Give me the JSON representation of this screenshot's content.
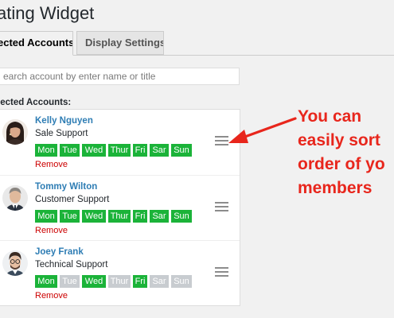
{
  "page_title": "ating Widget",
  "tabs": [
    {
      "label": "ected Accounts",
      "active": true
    },
    {
      "label": "Display Settings",
      "active": false
    }
  ],
  "search": {
    "placeholder": "earch account by enter name or title",
    "value": ""
  },
  "selected_label": "lected Accounts:",
  "members": [
    {
      "name": "Kelly Nguyen",
      "role": "Sale Support",
      "avatar_icon": "woman-portrait-icon",
      "days": [
        {
          "label": "Mon",
          "active": true
        },
        {
          "label": "Tue",
          "active": true
        },
        {
          "label": "Wed",
          "active": true
        },
        {
          "label": "Thur",
          "active": true
        },
        {
          "label": "Fri",
          "active": true
        },
        {
          "label": "Sar",
          "active": true
        },
        {
          "label": "Sun",
          "active": true
        }
      ],
      "remove_label": "Remove"
    },
    {
      "name": "Tommy Wilton",
      "role": "Customer Support",
      "avatar_icon": "man-portrait-icon",
      "days": [
        {
          "label": "Mon",
          "active": true
        },
        {
          "label": "Tue",
          "active": true
        },
        {
          "label": "Wed",
          "active": true
        },
        {
          "label": "Thur",
          "active": true
        },
        {
          "label": "Fri",
          "active": true
        },
        {
          "label": "Sar",
          "active": true
        },
        {
          "label": "Sun",
          "active": true
        }
      ],
      "remove_label": "Remove"
    },
    {
      "name": "Joey Frank",
      "role": "Technical Support",
      "avatar_icon": "man-glasses-portrait-icon",
      "days": [
        {
          "label": "Mon",
          "active": true
        },
        {
          "label": "Tue",
          "active": false
        },
        {
          "label": "Wed",
          "active": true
        },
        {
          "label": "Thur",
          "active": false
        },
        {
          "label": "Fri",
          "active": true
        },
        {
          "label": "Sar",
          "active": false
        },
        {
          "label": "Sun",
          "active": false
        }
      ],
      "remove_label": "Remove"
    }
  ],
  "callout": {
    "lines": [
      "You can",
      "easily sort",
      "order of yo",
      "members"
    ]
  },
  "colors": {
    "day_active": "#1bb339",
    "day_inactive": "#c8ccd0",
    "name_link": "#2e7db4",
    "remove_link": "#cc0000",
    "callout": "#e8261c",
    "drag_handle": "#8c8c8c"
  }
}
